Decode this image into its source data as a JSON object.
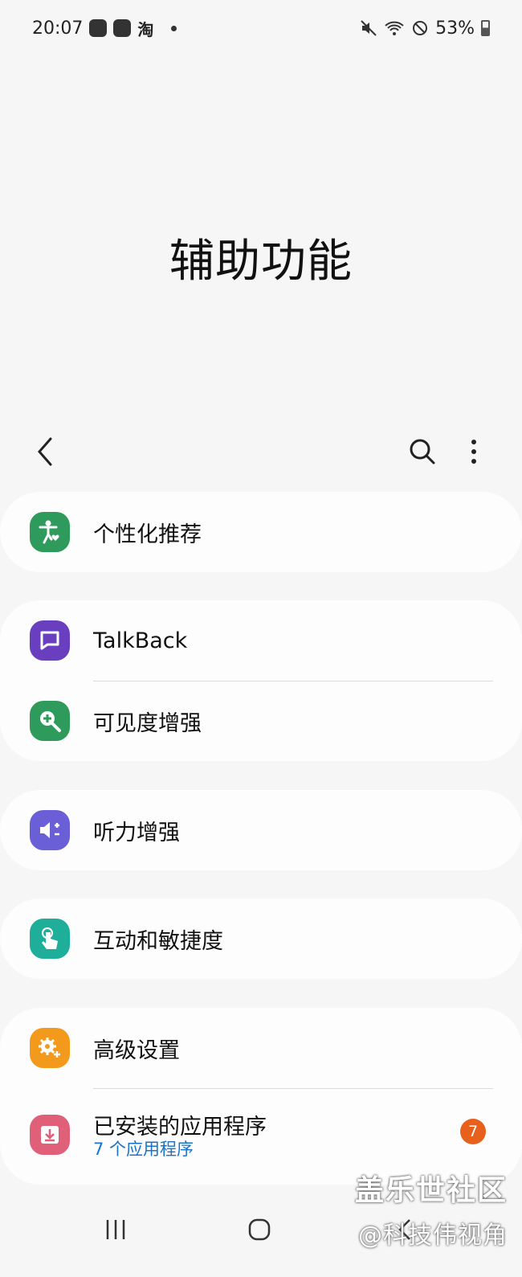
{
  "status_bar": {
    "time": "20:07",
    "tao_label": "淘",
    "battery": "53%",
    "icons": [
      "app-icon",
      "app-icon",
      "taobao-icon",
      "dot-icon",
      "mute-icon",
      "wifi-icon",
      "do-not-disturb-icon",
      "battery-icon"
    ]
  },
  "page": {
    "title": "辅助功能"
  },
  "toolbar": {
    "icons": [
      "back-icon",
      "search-icon",
      "more-options-icon"
    ]
  },
  "groups": [
    {
      "items": [
        {
          "label": "个性化推荐",
          "icon": "accessibility-person-icon",
          "color": "#2e9a5c"
        }
      ]
    },
    {
      "items": [
        {
          "label": "TalkBack",
          "icon": "speech-bubble-icon",
          "color": "#6a3fbf"
        },
        {
          "label": "可见度增强",
          "icon": "magnifier-plus-icon",
          "color": "#2e9a5c"
        }
      ]
    },
    {
      "items": [
        {
          "label": "听力增强",
          "icon": "volume-plus-minus-icon",
          "color": "#6a5fd6"
        }
      ]
    },
    {
      "items": [
        {
          "label": "互动和敏捷度",
          "icon": "touch-hand-icon",
          "color": "#1fae9a"
        }
      ]
    },
    {
      "items": [
        {
          "label": "高级设置",
          "icon": "gear-plus-icon",
          "color": "#f39a1d"
        },
        {
          "label": "已安装的应用程序",
          "sublabel": "7 个应用程序",
          "badge": "7",
          "icon": "download-tray-icon",
          "color": "#e0607a"
        }
      ]
    }
  ],
  "nav_bar": {
    "icons": [
      "recent-apps-icon",
      "home-icon",
      "back-nav-icon"
    ]
  },
  "watermark": {
    "line1": "盖乐世社区",
    "line2": "@科技伟视角"
  }
}
